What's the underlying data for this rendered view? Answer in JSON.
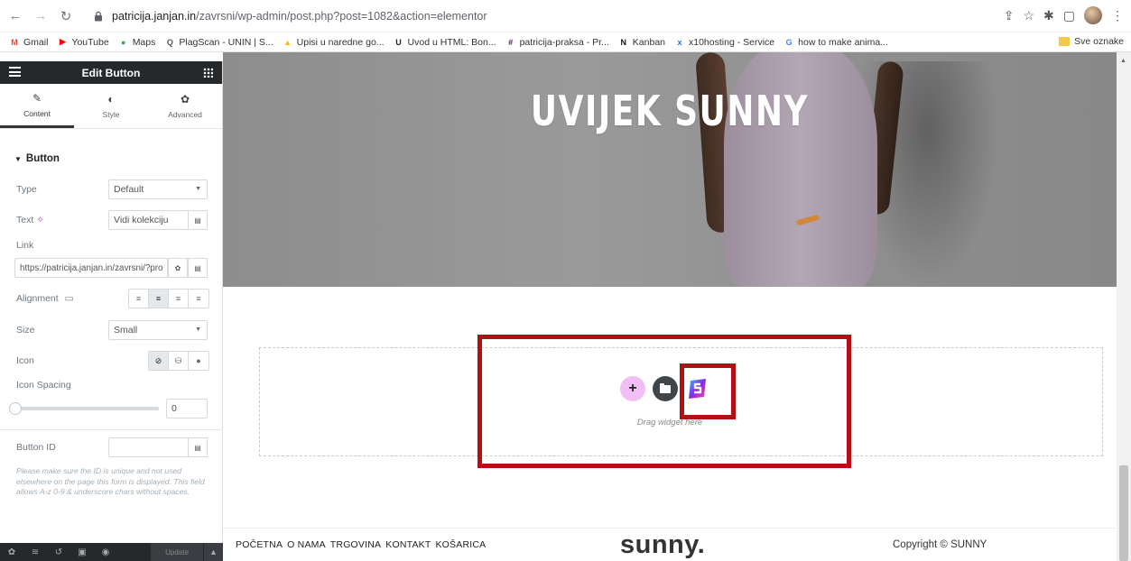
{
  "browser": {
    "url_host": "patricija.janjan.in",
    "url_path": "/zavrsni/wp-admin/post.php?post=1082&action=elementor",
    "bookmarks": [
      {
        "label": "Gmail",
        "icon": "gmail-icon",
        "color": "#ea4335",
        "glyph": "M"
      },
      {
        "label": "YouTube",
        "icon": "youtube-icon",
        "color": "#ff0000",
        "glyph": "▶"
      },
      {
        "label": "Maps",
        "icon": "maps-icon",
        "color": "#34a853",
        "glyph": "●"
      },
      {
        "label": "PlagScan - UNIN | S...",
        "icon": "plagscan-icon",
        "color": "#555555",
        "glyph": "Q"
      },
      {
        "label": "Upisi u naredne go...",
        "icon": "drive-icon",
        "color": "#fbbc04",
        "glyph": "▲"
      },
      {
        "label": "Uvod u HTML: Bon...",
        "icon": "udemy-icon",
        "color": "#222222",
        "glyph": "U"
      },
      {
        "label": "patricija-praksa - Pr...",
        "icon": "slack-icon",
        "color": "#4a154b",
        "glyph": "#"
      },
      {
        "label": "Kanban",
        "icon": "notion-icon",
        "color": "#111111",
        "glyph": "N"
      },
      {
        "label": "x10hosting - Service",
        "icon": "x10-icon",
        "color": "#1a73e8",
        "glyph": "x"
      },
      {
        "label": "how to make anima...",
        "icon": "google-icon",
        "color": "#4285f4",
        "glyph": "G"
      }
    ],
    "other_bookmarks": "Sve oznake"
  },
  "panel": {
    "title": "Edit Button",
    "tabs": [
      {
        "label": "Content",
        "icon": "pencil-icon",
        "glyph": "✎"
      },
      {
        "label": "Style",
        "icon": "contrast-icon",
        "glyph": "◐"
      },
      {
        "label": "Advanced",
        "icon": "gear-icon",
        "glyph": "✿"
      }
    ],
    "section": "Button",
    "type": {
      "label": "Type",
      "value": "Default"
    },
    "text": {
      "label": "Text",
      "value": "Vidi kolekciju"
    },
    "link": {
      "label": "Link",
      "value": "https://patricija.janjan.in/zavrsni/?pro"
    },
    "alignment": {
      "label": "Alignment"
    },
    "size": {
      "label": "Size",
      "value": "Small"
    },
    "icon": {
      "label": "Icon"
    },
    "icon_spacing": {
      "label": "Icon Spacing",
      "value": "0",
      "fraction": 0
    },
    "button_id": {
      "label": "Button ID",
      "value": ""
    },
    "note": "Please make sure the ID is unique and not used elsewhere on the page this form is displayed. This field allows A-z 0-9 & underscore chars without spaces.",
    "update_label": "Update"
  },
  "preview": {
    "hero_title": "UVIJEK SUNNY",
    "drop_text": "Drag widget here",
    "footer_nav": [
      "POČETNA",
      "O NAMA",
      "TRGOVINA",
      "KONTAKT",
      "KOŠARICA"
    ],
    "footer_logo": "sunny.",
    "footer_copy": "Copyright © SUNNY"
  },
  "colors": {
    "panel_header": "#26292c",
    "highlight": "#b40f14",
    "add_button": "#f1bff6",
    "ai_accent": "#8a2be2"
  }
}
